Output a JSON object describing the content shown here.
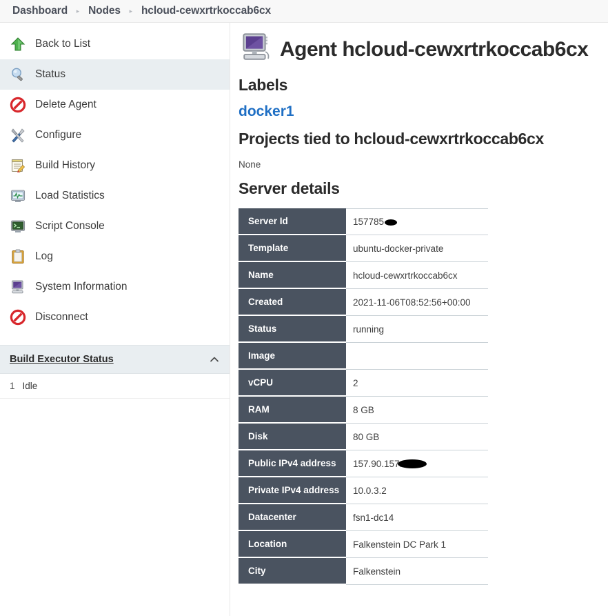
{
  "breadcrumb": {
    "items": [
      {
        "label": "Dashboard"
      },
      {
        "label": "Nodes"
      },
      {
        "label": "hcloud-cewxrtrkoccab6cx"
      }
    ],
    "separator": "▸"
  },
  "sidebar": {
    "items": [
      {
        "label": "Back to List",
        "icon": "up-arrow-icon",
        "active": false
      },
      {
        "label": "Status",
        "icon": "magnifier-icon",
        "active": true
      },
      {
        "label": "Delete Agent",
        "icon": "no-entry-icon",
        "active": false
      },
      {
        "label": "Configure",
        "icon": "wrench-screwdriver-icon",
        "active": false
      },
      {
        "label": "Build History",
        "icon": "notepad-pencil-icon",
        "active": false
      },
      {
        "label": "Load Statistics",
        "icon": "monitor-chart-icon",
        "active": false
      },
      {
        "label": "Script Console",
        "icon": "terminal-icon",
        "active": false
      },
      {
        "label": "Log",
        "icon": "clipboard-icon",
        "active": false
      },
      {
        "label": "System Information",
        "icon": "computer-icon",
        "active": false
      },
      {
        "label": "Disconnect",
        "icon": "no-entry-icon",
        "active": false
      }
    ],
    "build_executor_status": {
      "title": "Build Executor Status",
      "collapse_icon": "chevron-up-icon",
      "executors": [
        {
          "number": "1",
          "state": "Idle"
        }
      ]
    }
  },
  "main": {
    "agent_title": "Agent hcloud-cewxrtrkoccab6cx",
    "agent_icon": "computer-icon",
    "labels_heading": "Labels",
    "label_value": "docker1",
    "projects_heading": "Projects tied to hcloud-cewxrtrkoccab6cx",
    "projects_value": "None",
    "server_details_heading": "Server details",
    "server_details": [
      {
        "key": "Server Id",
        "value": "157785",
        "redacted": "small"
      },
      {
        "key": "Template",
        "value": "ubuntu-docker-private",
        "redacted": ""
      },
      {
        "key": "Name",
        "value": "hcloud-cewxrtrkoccab6cx",
        "redacted": ""
      },
      {
        "key": "Created",
        "value": "2021-11-06T08:52:56+00:00",
        "redacted": ""
      },
      {
        "key": "Status",
        "value": "running",
        "redacted": ""
      },
      {
        "key": "Image",
        "value": "",
        "redacted": ""
      },
      {
        "key": "vCPU",
        "value": "2",
        "redacted": ""
      },
      {
        "key": "RAM",
        "value": "8 GB",
        "redacted": ""
      },
      {
        "key": "Disk",
        "value": "80 GB",
        "redacted": ""
      },
      {
        "key": "Public IPv4 address",
        "value": "157.90.157.",
        "redacted": "wide"
      },
      {
        "key": "Private IPv4 address",
        "value": "10.0.3.2",
        "redacted": ""
      },
      {
        "key": "Datacenter",
        "value": "fsn1-dc14",
        "redacted": ""
      },
      {
        "key": "Location",
        "value": "Falkenstein DC Park 1",
        "redacted": ""
      },
      {
        "key": "City",
        "value": "Falkenstein",
        "redacted": ""
      }
    ]
  },
  "colors": {
    "table_header_bg": "#4a5360",
    "link_blue": "#1f6fc4",
    "sidebar_active_bg": "#e9eef1",
    "breadcrumb_bar_bg": "#f8f8f8"
  }
}
